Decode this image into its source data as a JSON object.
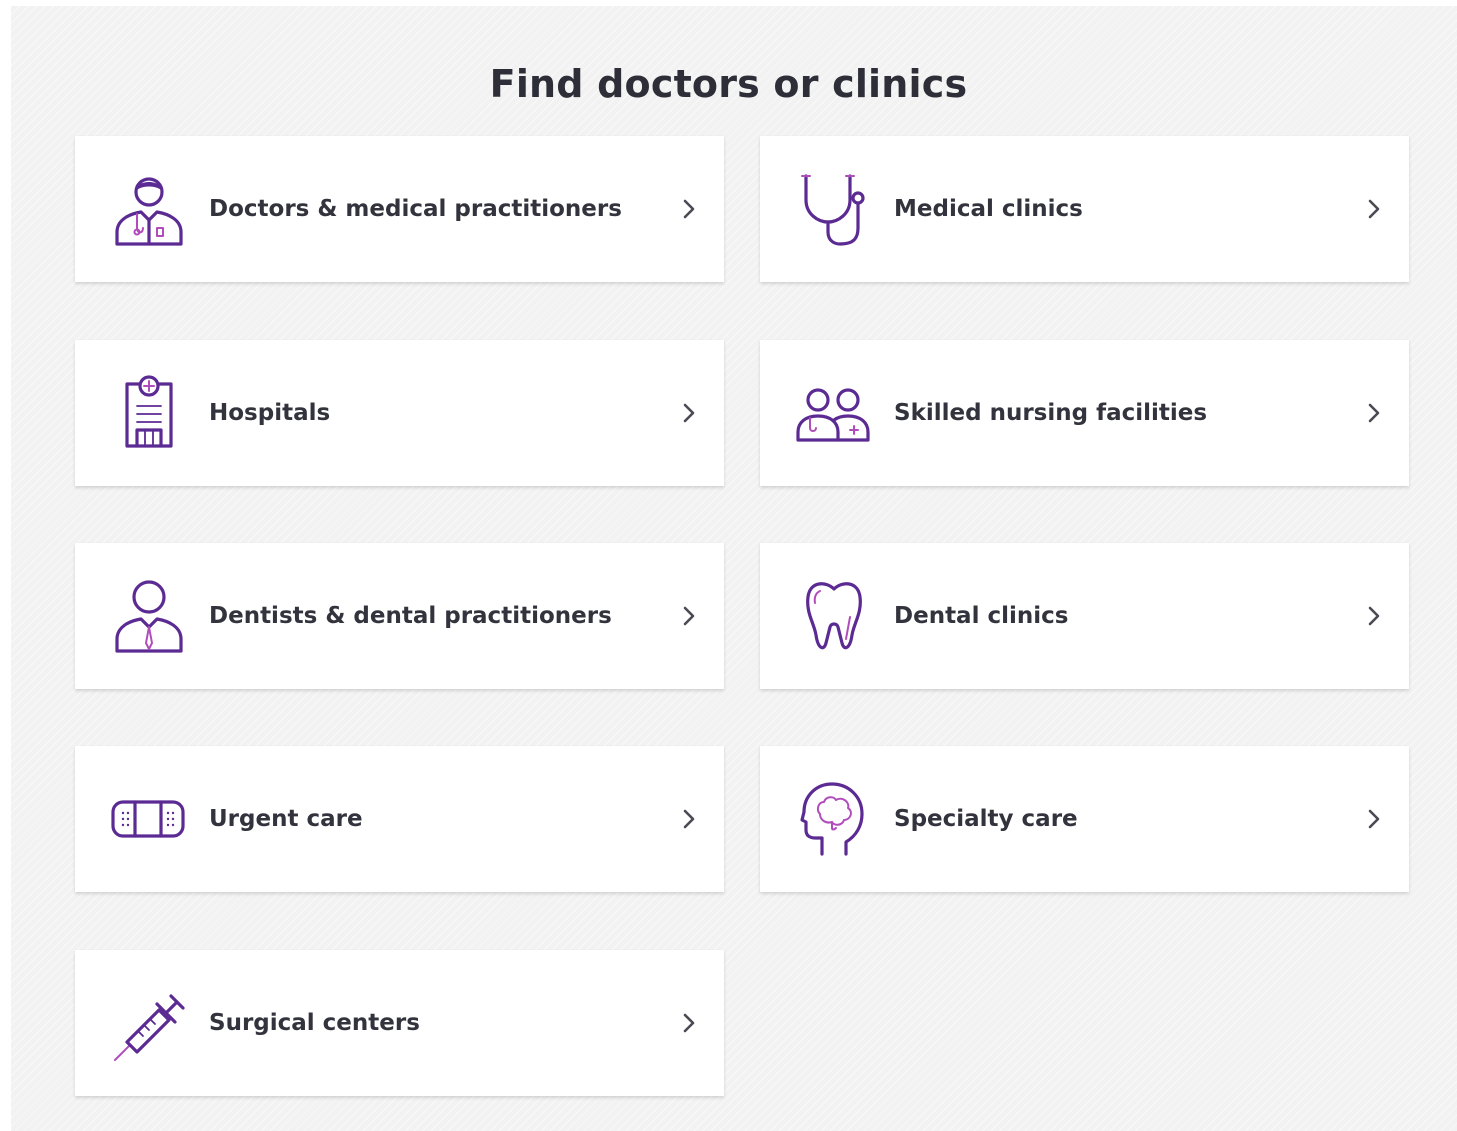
{
  "page": {
    "title": "Find doctors or clinics"
  },
  "cards": [
    {
      "label": "Doctors & medical practitioners",
      "icon": "doctor-icon"
    },
    {
      "label": "Medical clinics",
      "icon": "stethoscope-icon"
    },
    {
      "label": "Hospitals",
      "icon": "hospital-icon"
    },
    {
      "label": "Skilled nursing facilities",
      "icon": "nursing-staff-icon"
    },
    {
      "label": "Dentists & dental practitioners",
      "icon": "dentist-icon"
    },
    {
      "label": "Dental clinics",
      "icon": "tooth-icon"
    },
    {
      "label": "Urgent care",
      "icon": "bandage-icon"
    },
    {
      "label": "Specialty care",
      "icon": "brain-head-icon"
    },
    {
      "label": "Surgical centers",
      "icon": "syringe-icon"
    }
  ],
  "colors": {
    "icon_primary": "#5b2a93",
    "icon_accent": "#b04dbb",
    "text": "#33333d",
    "background": "#f2f2f2",
    "card": "#ffffff"
  }
}
